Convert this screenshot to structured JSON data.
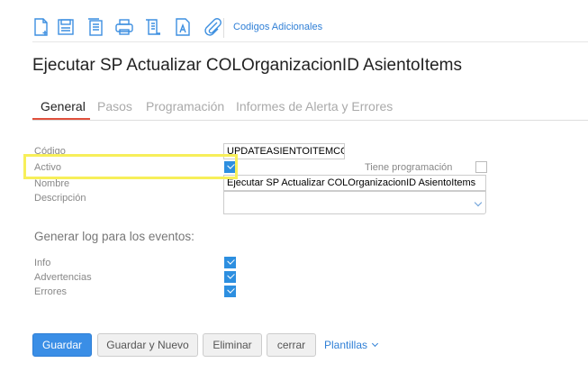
{
  "toolbar": {
    "icons": [
      "new-document-icon",
      "save-icon",
      "copy-icon",
      "print-icon",
      "script-icon",
      "font-document-icon",
      "attachment-icon"
    ],
    "link": "Codigos Adicionales"
  },
  "title": "Ejecutar SP Actualizar COLOrganizacionID AsientoItems",
  "tabs": [
    "General",
    "Pasos",
    "Programación",
    "Informes de Alerta y Errores"
  ],
  "form": {
    "codigo_label": "Código",
    "codigo_value": "UPDATEASIENTOITEMCOL",
    "activo_label": "Activo",
    "activo_checked": true,
    "tiene_programacion_label": "Tiene programación",
    "tiene_programacion_checked": false,
    "nombre_label": "Nombre",
    "nombre_value": "Ejecutar SP Actualizar COLOrganizacionID AsientoItems",
    "descripcion_label": "Descripción",
    "descripcion_value": ""
  },
  "log": {
    "heading": "Generar log para los eventos:",
    "items": [
      {
        "label": "Info",
        "checked": true
      },
      {
        "label": "Advertencias",
        "checked": true
      },
      {
        "label": "Errores",
        "checked": true
      }
    ]
  },
  "buttons": {
    "guardar": "Guardar",
    "guardar_nuevo": "Guardar y Nuevo",
    "eliminar": "Eliminar",
    "cerrar": "cerrar",
    "plantillas": "Plantillas"
  },
  "colors": {
    "accent": "#3a8ee6",
    "tab_underline": "#e0503c",
    "highlight": "#f7ef5a"
  }
}
